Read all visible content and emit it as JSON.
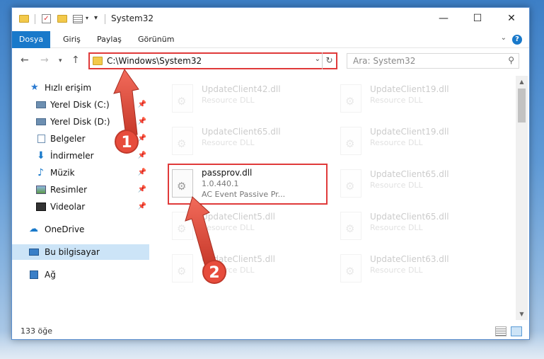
{
  "window": {
    "title": "System32",
    "controls": {
      "minimize": "—",
      "maximize": "☐",
      "close": "✕"
    }
  },
  "ribbon": {
    "tabs": [
      {
        "label": "Dosya",
        "active": true
      },
      {
        "label": "Giriş"
      },
      {
        "label": "Paylaş"
      },
      {
        "label": "Görünüm"
      }
    ],
    "help": "?"
  },
  "address_bar": {
    "path": "C:\\Windows\\System32"
  },
  "search": {
    "placeholder": "Ara: System32"
  },
  "nav_pane": {
    "quick_access_label": "Hızlı erişim",
    "quick_access_items": [
      {
        "label": "Yerel Disk (C:)",
        "icon": "drive-icon",
        "pinned": true
      },
      {
        "label": "Yerel Disk (D:)",
        "icon": "drive-icon",
        "pinned": true
      },
      {
        "label": "Belgeler",
        "icon": "documents-icon",
        "pinned": true
      },
      {
        "label": "İndirmeler",
        "icon": "downloads-icon",
        "pinned": true
      },
      {
        "label": "Müzik",
        "icon": "music-icon",
        "pinned": true
      },
      {
        "label": "Resimler",
        "icon": "pictures-icon",
        "pinned": true
      },
      {
        "label": "Videolar",
        "icon": "videos-icon",
        "pinned": true
      }
    ],
    "onedrive": "OneDrive",
    "this_pc": "Bu bilgisayar",
    "network": "Ağ"
  },
  "files": {
    "left": [
      {
        "name": "UpdateClient42.dll",
        "line2": "Resource DLL",
        "faded": true
      },
      {
        "name": "UpdateClient65.dll",
        "line2": "Resource DLL",
        "faded": true
      },
      {
        "name": "passprov.dll",
        "line2": "1.0.440.1",
        "line3": "AC Event Passive Pr...",
        "faded": false
      },
      {
        "name": "UpdateClient5.dll",
        "line2": "Resource DLL",
        "faded": true
      },
      {
        "name": "UpdateClient5.dll",
        "line2": "Resource DLL",
        "faded": true
      }
    ],
    "right": [
      {
        "name": "UpdateClient19.dll",
        "line2": "Resource DLL",
        "faded": true
      },
      {
        "name": "UpdateClient19.dll",
        "line2": "Resource DLL",
        "faded": true
      },
      {
        "name": "UpdateClient65.dll",
        "line2": "Resource DLL",
        "faded": true
      },
      {
        "name": "UpdateClient65.dll",
        "line2": "Resource DLL",
        "faded": true
      },
      {
        "name": "UpdateClient63.dll",
        "line2": "Resource DLL",
        "faded": true
      }
    ]
  },
  "status_bar": {
    "item_count": "133 öğe"
  },
  "callouts": [
    {
      "number": "1"
    },
    {
      "number": "2"
    }
  ],
  "colors": {
    "accent": "#1979ca",
    "highlight": "#e03a3a",
    "selected": "#cce4f7"
  }
}
